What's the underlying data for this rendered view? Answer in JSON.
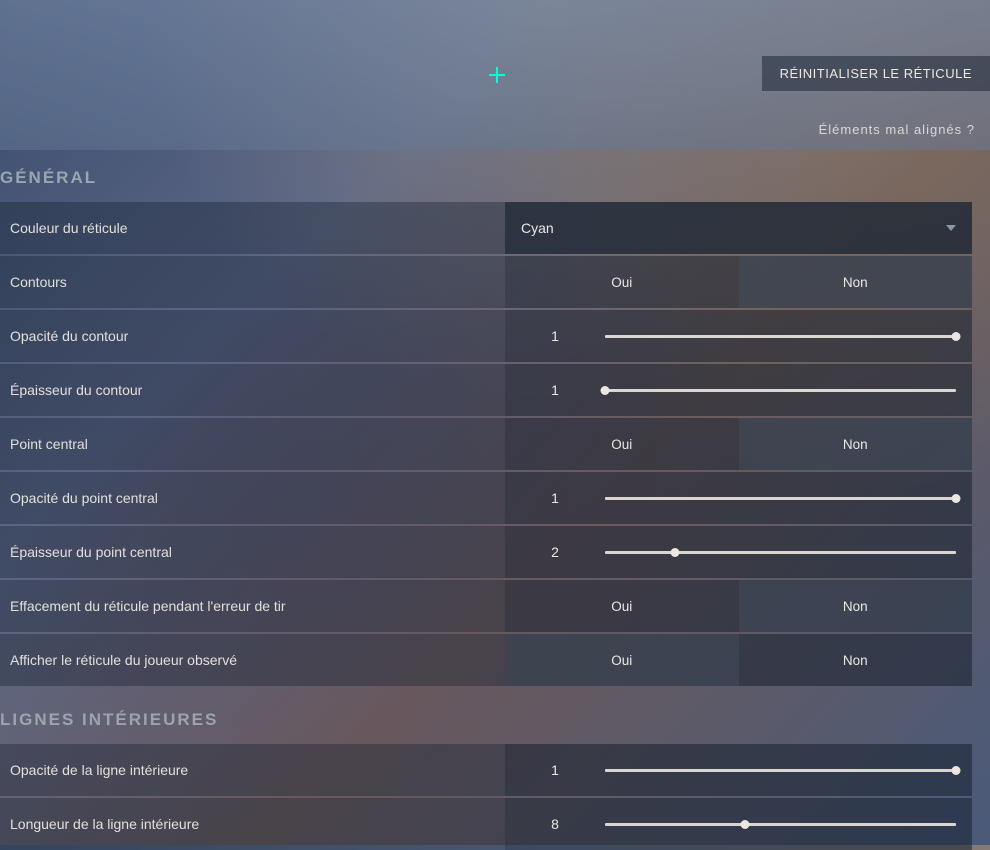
{
  "preview": {
    "reset_label": "RÉINITIALISER LE RÉTICULE",
    "misaligned_label": "Éléments mal alignés ?",
    "crosshair_color": "#00ffd4"
  },
  "sections": {
    "general": {
      "title": "GÉNÉRAL",
      "color": {
        "label": "Couleur du réticule",
        "value": "Cyan"
      },
      "outlines": {
        "label": "Contours",
        "yes": "Oui",
        "no": "Non",
        "selected": "Non"
      },
      "outline_opacity": {
        "label": "Opacité du contour",
        "value": "1",
        "percent": 100
      },
      "outline_thickness": {
        "label": "Épaisseur du contour",
        "value": "1",
        "percent": 0
      },
      "center_dot": {
        "label": "Point central",
        "yes": "Oui",
        "no": "Non",
        "selected": "Non"
      },
      "center_dot_opacity": {
        "label": "Opacité du point central",
        "value": "1",
        "percent": 100
      },
      "center_dot_thickness": {
        "label": "Épaisseur du point central",
        "value": "2",
        "percent": 20
      },
      "fade_with_error": {
        "label": "Effacement du réticule pendant l'erreur de tir",
        "yes": "Oui",
        "no": "Non",
        "selected": "Non"
      },
      "show_spectated": {
        "label": "Afficher le réticule du joueur observé",
        "yes": "Oui",
        "no": "Non",
        "selected": "Oui"
      }
    },
    "inner_lines": {
      "title": "LIGNES INTÉRIEURES",
      "inner_opacity": {
        "label": "Opacité de la ligne intérieure",
        "value": "1",
        "percent": 100
      },
      "inner_length": {
        "label": "Longueur de la ligne intérieure",
        "value": "8",
        "percent": 40
      }
    }
  }
}
